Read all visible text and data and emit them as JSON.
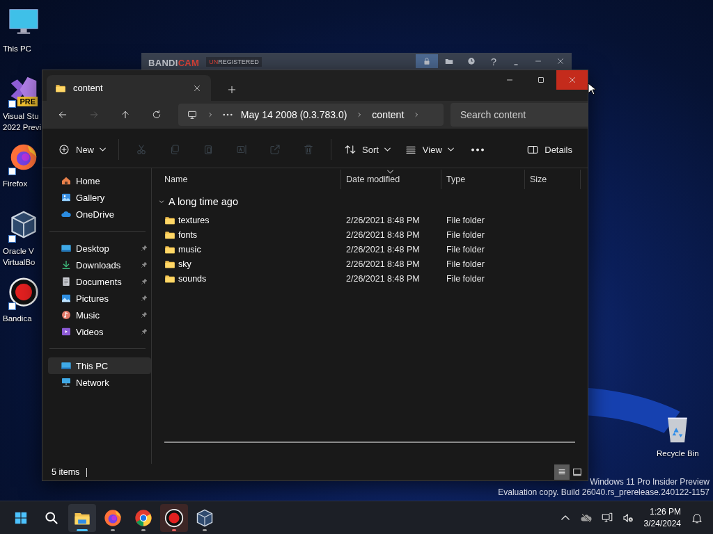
{
  "desktop": {
    "icons": [
      {
        "kind": "monitor",
        "label_lines": [
          "This PC"
        ]
      },
      {
        "kind": "visual-studio",
        "label_lines": [
          "Visual Stu",
          "2022 Previ"
        ],
        "badge": "PRE"
      },
      {
        "kind": "firefox",
        "label_lines": [
          "Firefox"
        ]
      },
      {
        "kind": "virtualbox",
        "label_lines": [
          "Oracle V",
          "VirtualBo"
        ]
      },
      {
        "kind": "bandicam",
        "label_lines": [
          "Bandica"
        ]
      }
    ],
    "recycle_bin": {
      "label": "Recycle Bin"
    }
  },
  "bandicam_bar": {
    "brand_parts": [
      "BANDI",
      "CAM"
    ],
    "status_parts": [
      "UN",
      "REGISTERED"
    ],
    "buttons": [
      {
        "kind": "lock",
        "selected": true
      },
      {
        "kind": "folder",
        "selected": false
      },
      {
        "kind": "clock",
        "selected": false
      },
      {
        "kind": "help",
        "label": "?",
        "selected": false
      },
      {
        "kind": "tray",
        "selected": false
      },
      {
        "kind": "minimize",
        "selected": false
      },
      {
        "kind": "close",
        "selected": false
      }
    ]
  },
  "explorer": {
    "tabs": [
      {
        "title": "content",
        "selected": true
      }
    ],
    "nav_buttons": [
      {
        "kind": "back",
        "disabled": false
      },
      {
        "kind": "forward",
        "disabled": true
      },
      {
        "kind": "up",
        "disabled": false
      },
      {
        "kind": "refresh",
        "disabled": false
      }
    ],
    "breadcrumb": [
      "May 14 2008 (0.3.783.0)",
      "content"
    ],
    "search": {
      "placeholder": "Search content"
    },
    "toolbar": [
      {
        "kind": "new",
        "label": "New",
        "menu": true,
        "disabled": false
      },
      {
        "kind": "cut",
        "disabled": true
      },
      {
        "kind": "copy",
        "disabled": true
      },
      {
        "kind": "paste",
        "disabled": true
      },
      {
        "kind": "rename",
        "disabled": true
      },
      {
        "kind": "share",
        "disabled": true
      },
      {
        "kind": "delete",
        "disabled": true
      },
      {
        "kind": "sort",
        "label": "Sort",
        "menu": true,
        "disabled": false
      },
      {
        "kind": "view",
        "label": "View",
        "menu": true,
        "disabled": false
      },
      {
        "kind": "more",
        "disabled": false
      },
      {
        "kind": "details",
        "label": "Details",
        "disabled": false
      }
    ],
    "sidebar": [
      [
        {
          "kind": "home",
          "label": "Home",
          "pinned": false,
          "selected": false
        },
        {
          "kind": "gallery",
          "label": "Gallery",
          "pinned": false,
          "selected": false
        },
        {
          "kind": "cloud",
          "label": "OneDrive",
          "pinned": false,
          "selected": false
        }
      ],
      [
        {
          "kind": "desktop",
          "label": "Desktop",
          "pinned": true,
          "selected": false
        },
        {
          "kind": "download",
          "label": "Downloads",
          "pinned": true,
          "selected": false
        },
        {
          "kind": "document",
          "label": "Documents",
          "pinned": true,
          "selected": false
        },
        {
          "kind": "picture",
          "label": "Pictures",
          "pinned": true,
          "selected": false
        },
        {
          "kind": "music",
          "label": "Music",
          "pinned": true,
          "selected": false
        },
        {
          "kind": "video",
          "label": "Videos",
          "pinned": true,
          "selected": false
        }
      ],
      [
        {
          "kind": "pc",
          "label": "This PC",
          "pinned": false,
          "selected": true
        },
        {
          "kind": "network",
          "label": "Network",
          "pinned": false,
          "selected": false
        }
      ]
    ],
    "columns": [
      {
        "label": "Name",
        "sorted": false
      },
      {
        "label": "Date modified",
        "sorted": true
      },
      {
        "label": "Type",
        "sorted": false
      },
      {
        "label": "Size",
        "sorted": false
      }
    ],
    "groups": [
      {
        "label": "A long time ago",
        "expanded": true,
        "rows": [
          {
            "name": "textures",
            "date": "2/26/2021 8:48 PM",
            "type": "File folder"
          },
          {
            "name": "fonts",
            "date": "2/26/2021 8:48 PM",
            "type": "File folder"
          },
          {
            "name": "music",
            "date": "2/26/2021 8:48 PM",
            "type": "File folder"
          },
          {
            "name": "sky",
            "date": "2/26/2021 8:48 PM",
            "type": "File folder"
          },
          {
            "name": "sounds",
            "date": "2/26/2021 8:48 PM",
            "type": "File folder"
          }
        ]
      }
    ],
    "status": {
      "count": "5 items",
      "views": [
        {
          "kind": "details",
          "selected": true
        },
        {
          "kind": "tiles",
          "selected": false
        }
      ]
    }
  },
  "os_notice": [
    "Windows 11 Pro Insider Preview",
    "Evaluation copy. Build 26040.rs_prerelease.240122-1157"
  ],
  "taskbar": {
    "apps": [
      {
        "kind": "start",
        "running": false,
        "active": false,
        "attention": false
      },
      {
        "kind": "search",
        "running": false,
        "active": false,
        "attention": false
      },
      {
        "kind": "explorer",
        "running": true,
        "active": true,
        "attention": false
      },
      {
        "kind": "firefox",
        "running": true,
        "active": false,
        "attention": false
      },
      {
        "kind": "chrome",
        "running": true,
        "active": false,
        "attention": false
      },
      {
        "kind": "bandicam",
        "running": true,
        "active": false,
        "attention": true
      },
      {
        "kind": "virtualbox",
        "running": true,
        "active": false,
        "attention": false
      }
    ],
    "tray": [
      {
        "kind": "caret"
      },
      {
        "kind": "cloud-off"
      },
      {
        "kind": "network"
      },
      {
        "kind": "volume-muted"
      }
    ],
    "time": "1:26 PM",
    "date": "3/24/2024"
  }
}
